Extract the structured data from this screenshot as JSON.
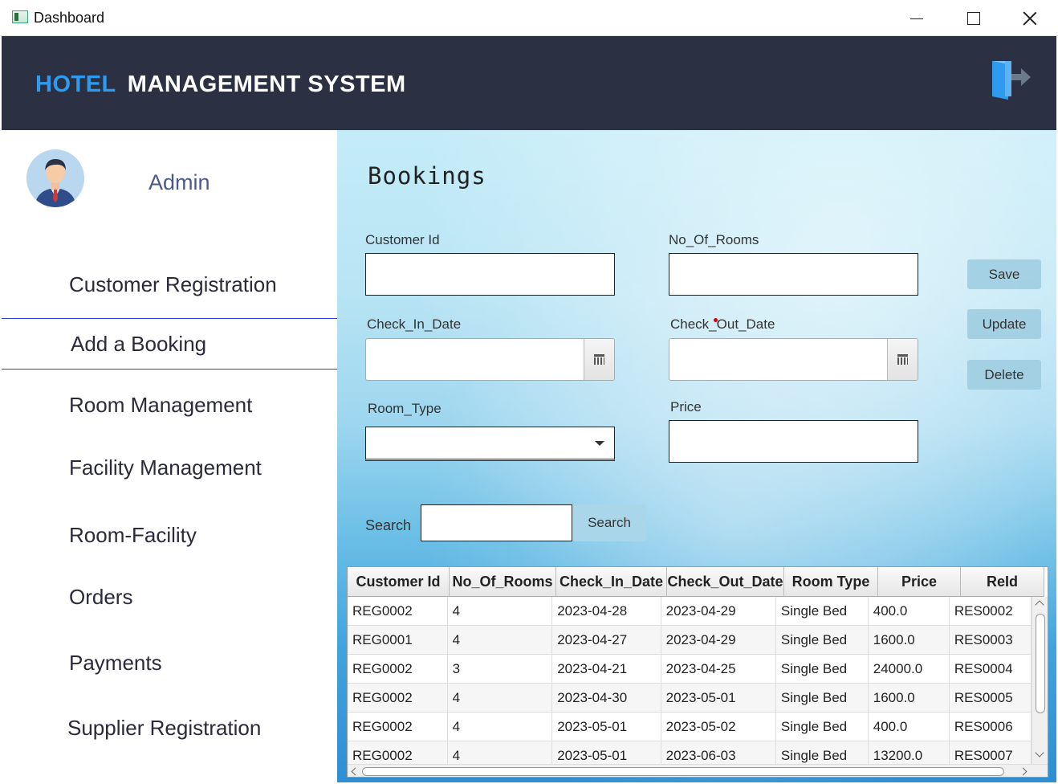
{
  "window": {
    "title": "Dashboard"
  },
  "header": {
    "brand_first": "HOTEL",
    "brand_rest": "MANAGEMENT SYSTEM",
    "logout_icon": "logout-door-icon"
  },
  "sidebar": {
    "user": "Admin",
    "items": [
      {
        "label": "Customer Registration",
        "active": false
      },
      {
        "label": "Add a Booking",
        "active": true
      },
      {
        "label": "Room Management",
        "active": false
      },
      {
        "label": "Facility Management",
        "active": false
      },
      {
        "label": "Room-Facility",
        "active": false
      },
      {
        "label": "Orders",
        "active": false
      },
      {
        "label": "Payments",
        "active": false
      },
      {
        "label": "Supplier Registration",
        "active": false
      }
    ]
  },
  "form": {
    "title": "Bookings",
    "customer_id_label": "Customer Id",
    "customer_id_value": "",
    "rooms_label": "No_Of_Rooms",
    "rooms_value": "",
    "check_in_label": "Check_In_Date",
    "check_in_value": "",
    "check_out_label": "Check_Out_Date",
    "check_out_value": "",
    "room_type_label": "Room_Type",
    "room_type_value": "",
    "price_label": "Price",
    "price_value": "",
    "save": "Save",
    "update": "Update",
    "delete": "Delete",
    "search_label": "Search",
    "search_value": "",
    "search_button": "Search"
  },
  "table": {
    "columns": [
      "Customer Id",
      "No_Of_Rooms",
      "Check_In_Date",
      "Check_Out_Date",
      "Room Type",
      "Price",
      "ReId"
    ],
    "rows": [
      [
        "REG0002",
        "4",
        "2023-04-28",
        "2023-04-29",
        "Single Bed",
        "400.0",
        "RES0002"
      ],
      [
        "REG0001",
        "4",
        "2023-04-27",
        "2023-04-29",
        "Single Bed",
        "1600.0",
        "RES0003"
      ],
      [
        "REG0002",
        "3",
        "2023-04-21",
        "2023-04-25",
        "Single Bed",
        "24000.0",
        "RES0004"
      ],
      [
        "REG0002",
        "4",
        "2023-04-30",
        "2023-05-01",
        "Single Bed",
        "1600.0",
        "RES0005"
      ],
      [
        "REG0002",
        "4",
        "2023-05-01",
        "2023-05-02",
        "Single Bed",
        "400.0",
        "RES0006"
      ],
      [
        "REG0002",
        "4",
        "2023-05-01",
        "2023-06-03",
        "Single Bed",
        "13200.0",
        "RES0007"
      ]
    ]
  }
}
